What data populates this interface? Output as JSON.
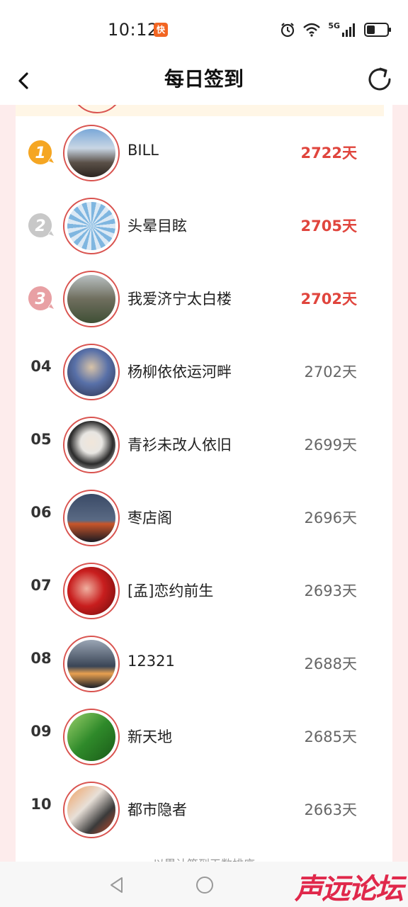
{
  "status_bar": {
    "time": "10:12",
    "app_badge": "快",
    "network": "5G",
    "icons": [
      "alarm-icon",
      "wifi-icon",
      "signal-icon",
      "battery-icon"
    ]
  },
  "header": {
    "title": "每日签到",
    "back_icon": "back-arrow-icon",
    "refresh_icon": "refresh-icon"
  },
  "ranking": [
    {
      "rank": "1",
      "medal": "gold",
      "name": "BILL",
      "days": "2722天"
    },
    {
      "rank": "2",
      "medal": "silver",
      "name": "头晕目眩",
      "days": "2705天"
    },
    {
      "rank": "3",
      "medal": "bronze",
      "name": "我爱济宁太白楼",
      "days": "2702天"
    },
    {
      "rank": "04",
      "name": "杨柳依依运河畔",
      "days": "2702天"
    },
    {
      "rank": "05",
      "name": "青衫未改人依旧",
      "days": "2699天"
    },
    {
      "rank": "06",
      "name": "枣店阁",
      "days": "2696天"
    },
    {
      "rank": "07",
      "name": "[孟]恋约前生",
      "days": "2693天"
    },
    {
      "rank": "08",
      "name": "12321",
      "days": "2688天"
    },
    {
      "rank": "09",
      "name": "新天地",
      "days": "2685天"
    },
    {
      "rank": "10",
      "name": "都市隐者",
      "days": "2663天"
    }
  ],
  "footer_note": "以累计签到天数排序",
  "nav": {
    "back_icon": "triangle-back-icon",
    "home_icon": "circle-home-icon"
  },
  "watermark": "声远论坛",
  "colors": {
    "accent_red": "#e0453d",
    "avatar_border": "#d9534f",
    "page_bg": "#fdecec",
    "gold": "#f5a623",
    "silver": "#c8c8c8",
    "bronze": "#e8a0a4"
  }
}
